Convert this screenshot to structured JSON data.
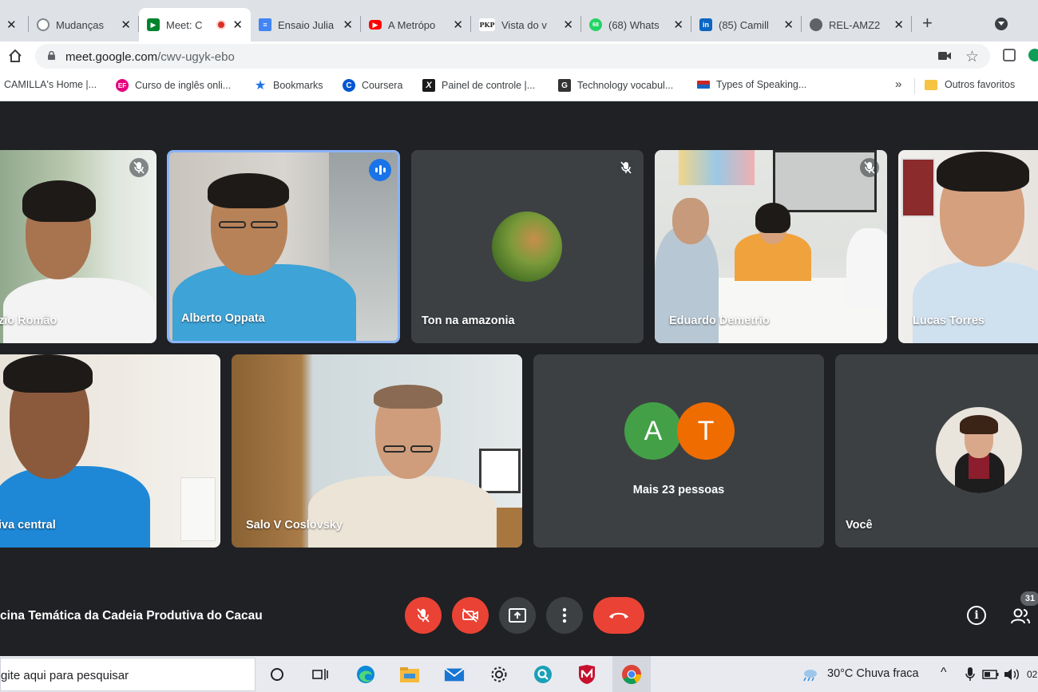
{
  "tabs": [
    {
      "title": "Mudanças",
      "icon": "settings-circle-icon",
      "color": "#80868b"
    },
    {
      "title": "Meet: C",
      "icon": "google-meet-icon",
      "color": "#00832d",
      "active": true,
      "recording": true
    },
    {
      "title": "Ensaio Julia",
      "icon": "google-docs-icon",
      "color": "#4285f4"
    },
    {
      "title": "A Metrópo",
      "icon": "youtube-icon",
      "color": "#ff0000"
    },
    {
      "title": "Vista do v",
      "icon": "pkp-icon",
      "color": "#222222",
      "badge": "PKP"
    },
    {
      "title": "(68) Whats",
      "icon": "whatsapp-icon",
      "color": "#25d366",
      "badge": "68"
    },
    {
      "title": "(85) Camill",
      "icon": "linkedin-icon",
      "color": "#0a66c2",
      "badge": "in"
    },
    {
      "title": "REL-AMZ2",
      "icon": "globe-icon",
      "color": "#5f6368"
    }
  ],
  "address": {
    "host": "meet.google.com",
    "path": "/cwv-ugyk-ebo"
  },
  "bookmarks": [
    {
      "label": "CAMILLA's Home |...",
      "icon": "none"
    },
    {
      "label": "Curso de inglês onli...",
      "icon": "ef-icon",
      "color": "#e6007e",
      "badge": "EF"
    },
    {
      "label": "Bookmarks",
      "icon": "star-icon",
      "color": "#1a73e8"
    },
    {
      "label": "Coursera",
      "icon": "coursera-icon",
      "color": "#0056d2",
      "badge": "C"
    },
    {
      "label": "Painel de controle |...",
      "icon": "x-icon",
      "color": "#1a1a1a",
      "badge": "X"
    },
    {
      "label": "Technology vocabul...",
      "icon": "g-icon",
      "color": "#333333",
      "badge": "G"
    },
    {
      "label": "Types of Speaking...",
      "icon": "flag-icon",
      "color": "#c62828"
    }
  ],
  "bookmarks_more": "»",
  "other_bookmarks": "Outros favoritos",
  "participants": {
    "row1": [
      {
        "name": "zio Romão",
        "muted": true
      },
      {
        "name": "Alberto Oppata",
        "speaking": true
      },
      {
        "name": "Ton na amazonia",
        "muted": true
      },
      {
        "name": "Eduardo Demetrio",
        "muted": true
      },
      {
        "name": "Lucas Torres"
      }
    ],
    "row2": [
      {
        "name": "iva central"
      },
      {
        "name": "Salo V Coslovsky"
      },
      {
        "name": "Mais 23 pessoas",
        "letters": [
          "A",
          "T"
        ],
        "colors": [
          "#43a047",
          "#ef6c00"
        ]
      },
      {
        "name": "Você"
      }
    ]
  },
  "meeting_title": "cina Temática da Cadeia Produtiva do Cacau",
  "people_count": "31",
  "taskbar": {
    "search_placeholder": "gite aqui para pesquisar",
    "weather": "30°C  Chuva fraca",
    "clock": "02"
  },
  "colors": {
    "meet_bg": "#202124",
    "tile_bg": "#3c4043",
    "danger": "#ea4335",
    "speaking_border": "#8ab4f8"
  }
}
